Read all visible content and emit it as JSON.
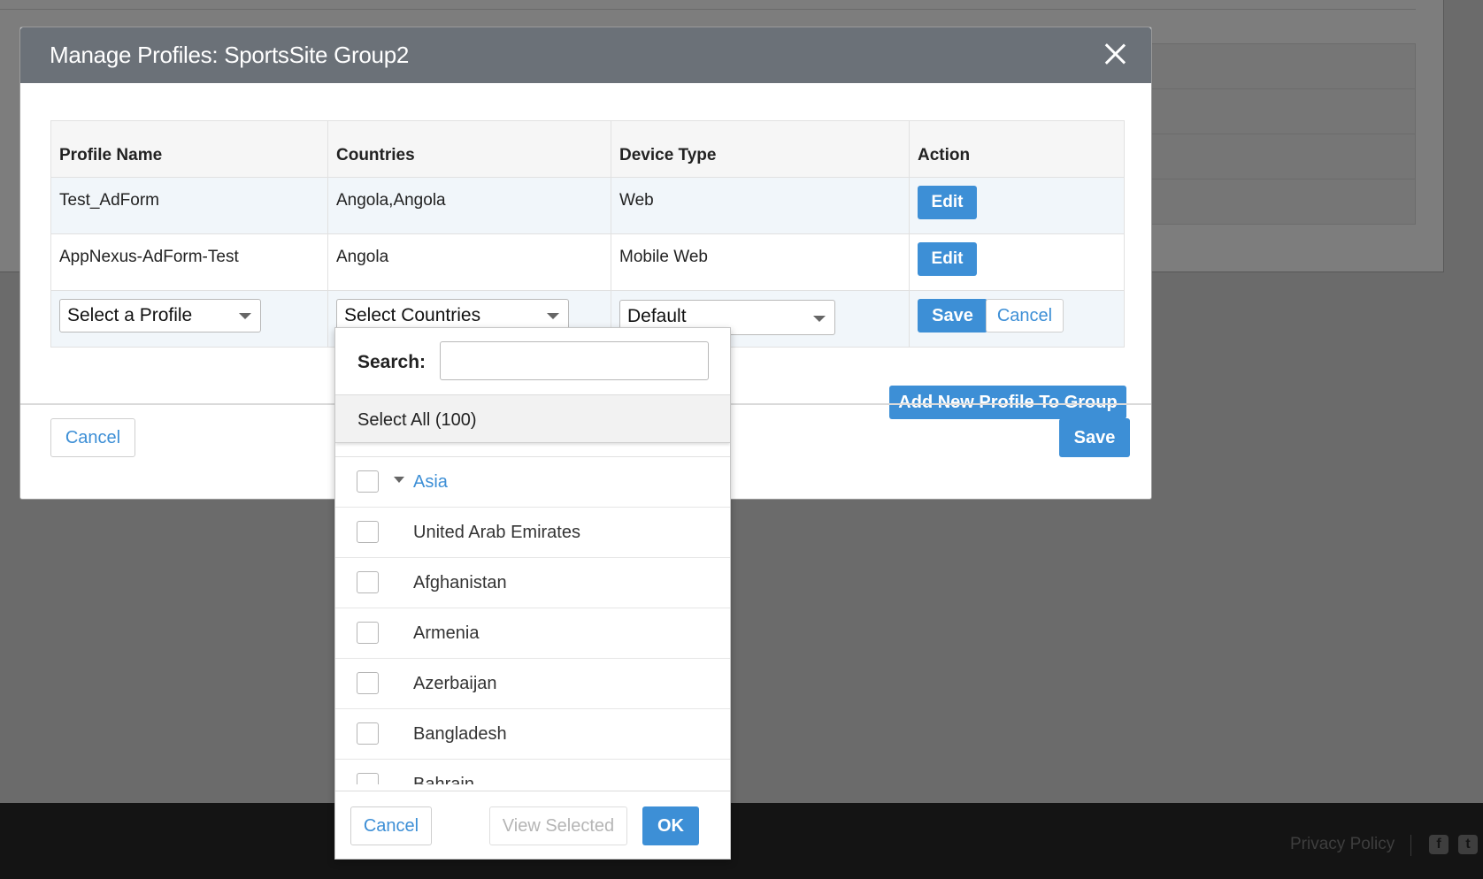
{
  "modal": {
    "title": "Manage Profiles: SportsSite Group2",
    "columns": [
      "Profile Name",
      "Countries",
      "Device Type",
      "Action"
    ],
    "rows": [
      {
        "profile": "Test_AdForm",
        "countries": "Angola,Angola",
        "device": "Web",
        "action": "Edit"
      },
      {
        "profile": "AppNexus-AdForm-Test",
        "countries": "Angola",
        "device": "Mobile Web",
        "action": "Edit"
      }
    ],
    "edit_row": {
      "profile_select": "Select a Profile",
      "countries_select": "Select Countries",
      "device_select": "Default",
      "save": "Save",
      "cancel": "Cancel"
    },
    "add_button": "Add New Profile To Group",
    "footer_cancel": "Cancel",
    "footer_save": "Save"
  },
  "dropdown": {
    "search_label": "Search:",
    "search_value": "",
    "select_all": "Select All (100)",
    "group": "Asia",
    "countries": [
      "United Arab Emirates",
      "Afghanistan",
      "Armenia",
      "Azerbaijan",
      "Bangladesh",
      "Bahrain"
    ],
    "cancel": "Cancel",
    "view_selected": "View Selected",
    "ok": "OK"
  },
  "footer": {
    "privacy": "Privacy Policy",
    "icons": [
      "facebook-icon",
      "twitter-icon"
    ]
  },
  "colors": {
    "accent": "#3d8fd6",
    "header_bg": "#6b7178"
  }
}
